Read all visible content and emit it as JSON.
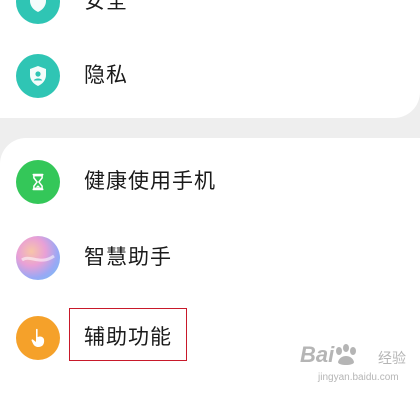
{
  "settings": {
    "items": [
      {
        "label": "安全",
        "icon": "security-icon",
        "color": "#2fc5b4"
      },
      {
        "label": "隐私",
        "icon": "privacy-shield-icon",
        "color": "#2fc5b4"
      },
      {
        "label": "健康使用手机",
        "icon": "hourglass-icon",
        "color": "#34c759"
      },
      {
        "label": "智慧助手",
        "icon": "smart-assistant-icon",
        "color": "#c792ea"
      },
      {
        "label": "辅助功能",
        "icon": "accessibility-hand-icon",
        "color": "#f5a12a"
      }
    ]
  },
  "annotation": {
    "highlight_color": "#c8192a"
  },
  "watermark": {
    "brand": "Bai",
    "sub": "经验",
    "url": "jingyan.baidu.com"
  }
}
